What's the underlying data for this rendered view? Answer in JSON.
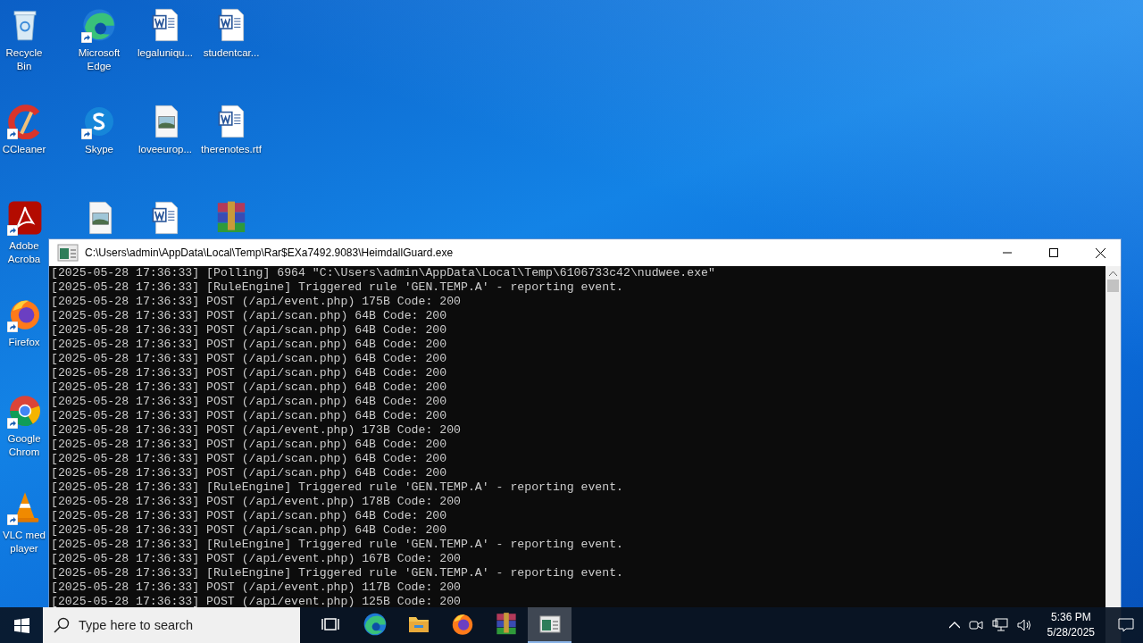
{
  "desktop_columns": [
    [
      {
        "kind": "recycle-bin",
        "label": "Recycle Bin",
        "shortcut": false
      },
      {
        "kind": "ccleaner",
        "label": "CCleaner",
        "shortcut": true
      },
      {
        "kind": "pdf",
        "label": "Adobe Acroba",
        "shortcut": true
      },
      {
        "kind": "firefox",
        "label": "Firefox",
        "shortcut": true
      },
      {
        "kind": "chrome",
        "label": "Google Chrom",
        "shortcut": true
      },
      {
        "kind": "vlc",
        "label": "VLC med player",
        "shortcut": true
      }
    ],
    [
      {
        "kind": "edge",
        "label": "Microsoft Edge",
        "shortcut": true
      },
      {
        "kind": "skype",
        "label": "Skype",
        "shortcut": true
      },
      {
        "kind": "image",
        "shortcut": false
      }
    ],
    [
      {
        "kind": "word",
        "label": "legaluniqu...",
        "shortcut": false
      },
      {
        "kind": "image",
        "label": "loveeurop...",
        "shortcut": false
      },
      {
        "kind": "word",
        "shortcut": false
      }
    ],
    [
      {
        "kind": "word",
        "label": "studentcar...",
        "shortcut": false
      },
      {
        "kind": "word",
        "label": "therenotes.rtf",
        "shortcut": false
      },
      {
        "kind": "winrar",
        "shortcut": false
      }
    ]
  ],
  "console_window": {
    "title": "C:\\Users\\admin\\AppData\\Local\\Temp\\Rar$EXa7492.9083\\HeimdallGuard.exe",
    "lines": [
      "[2025-05-28 17:36:33] [Polling] 6964 \"C:\\Users\\admin\\AppData\\Local\\Temp\\6106733c42\\nudwee.exe\"",
      "[2025-05-28 17:36:33] [RuleEngine] Triggered rule 'GEN.TEMP.A' - reporting event.",
      "[2025-05-28 17:36:33] POST (/api/event.php) 175B Code: 200",
      "[2025-05-28 17:36:33] POST (/api/scan.php) 64B Code: 200",
      "[2025-05-28 17:36:33] POST (/api/scan.php) 64B Code: 200",
      "[2025-05-28 17:36:33] POST (/api/scan.php) 64B Code: 200",
      "[2025-05-28 17:36:33] POST (/api/scan.php) 64B Code: 200",
      "[2025-05-28 17:36:33] POST (/api/scan.php) 64B Code: 200",
      "[2025-05-28 17:36:33] POST (/api/scan.php) 64B Code: 200",
      "[2025-05-28 17:36:33] POST (/api/scan.php) 64B Code: 200",
      "[2025-05-28 17:36:33] POST (/api/scan.php) 64B Code: 200",
      "[2025-05-28 17:36:33] POST (/api/event.php) 173B Code: 200",
      "[2025-05-28 17:36:33] POST (/api/scan.php) 64B Code: 200",
      "[2025-05-28 17:36:33] POST (/api/scan.php) 64B Code: 200",
      "[2025-05-28 17:36:33] POST (/api/scan.php) 64B Code: 200",
      "[2025-05-28 17:36:33] [RuleEngine] Triggered rule 'GEN.TEMP.A' - reporting event.",
      "[2025-05-28 17:36:33] POST (/api/event.php) 178B Code: 200",
      "[2025-05-28 17:36:33] POST (/api/scan.php) 64B Code: 200",
      "[2025-05-28 17:36:33] POST (/api/scan.php) 64B Code: 200",
      "[2025-05-28 17:36:33] [RuleEngine] Triggered rule 'GEN.TEMP.A' - reporting event.",
      "[2025-05-28 17:36:33] POST (/api/event.php) 167B Code: 200",
      "[2025-05-28 17:36:33] [RuleEngine] Triggered rule 'GEN.TEMP.A' - reporting event.",
      "[2025-05-28 17:36:33] POST (/api/event.php) 117B Code: 200",
      "[2025-05-28 17:36:33] POST (/api/event.php) 125B Code: 200"
    ]
  },
  "taskbar": {
    "search": {
      "placeholder": "Type here to search"
    },
    "apps": [
      {
        "kind": "task-view",
        "active": false
      },
      {
        "kind": "edge",
        "active": false
      },
      {
        "kind": "explorer",
        "active": false
      },
      {
        "kind": "firefox",
        "active": false
      },
      {
        "kind": "winrar",
        "active": false
      },
      {
        "kind": "console",
        "active": true
      }
    ],
    "clock": {
      "time": "5:36 PM",
      "date": "5/28/2025"
    }
  }
}
